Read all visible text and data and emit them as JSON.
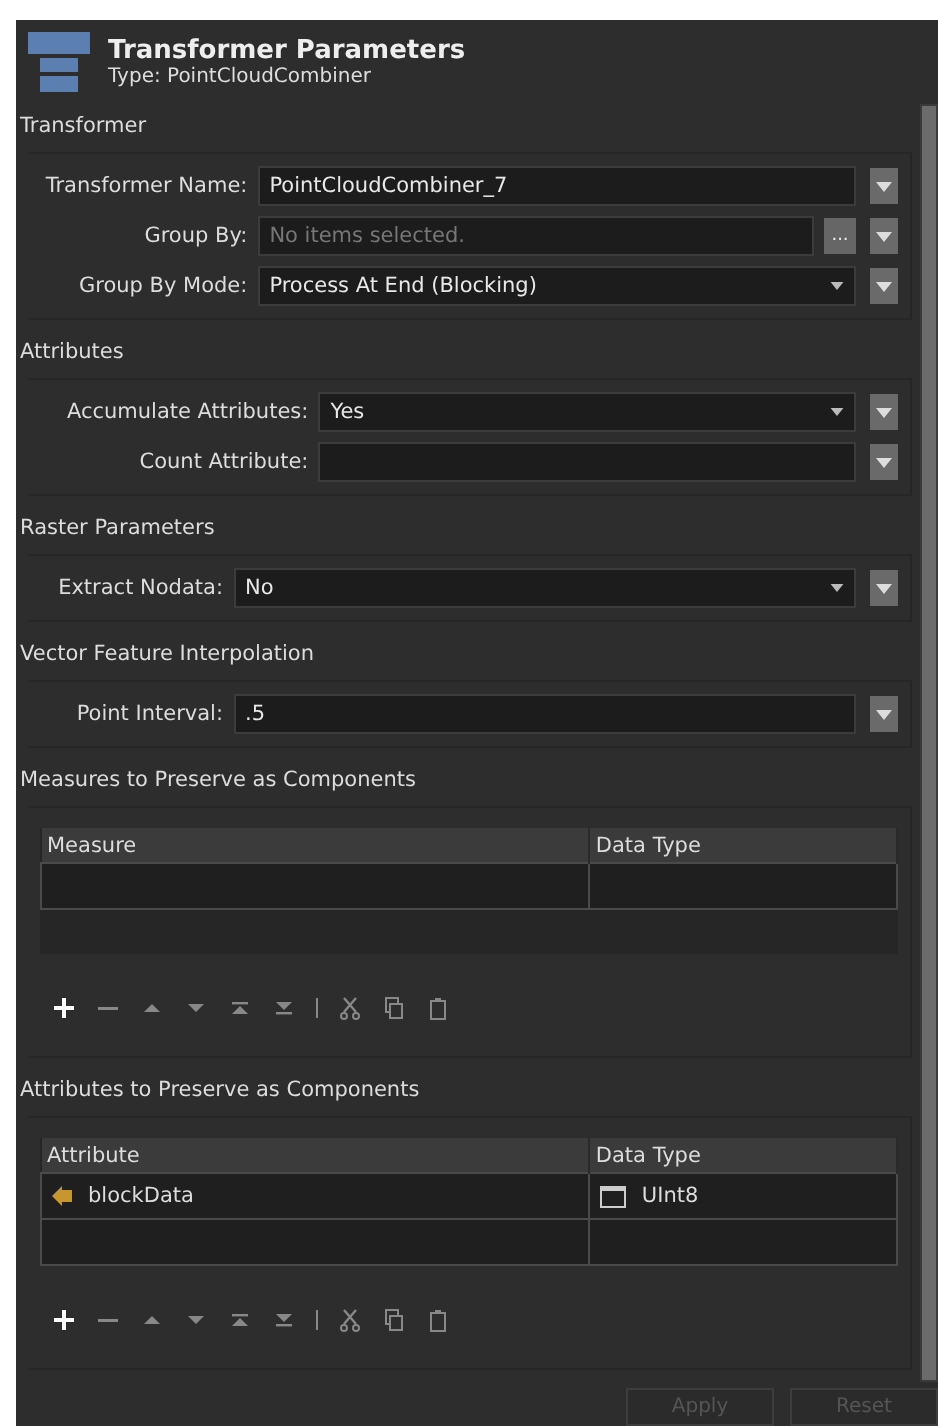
{
  "header": {
    "title": "Transformer Parameters",
    "subtitle": "Type: PointCloudCombiner"
  },
  "sections": [
    {
      "title": "Transformer",
      "kind": "form",
      "fields": [
        {
          "label": "Transformer Name:",
          "kind": "text",
          "value": "PointCloudCombiner_7"
        },
        {
          "label": "Group By:",
          "kind": "chooser",
          "placeholder": "No items selected.",
          "button": "..."
        },
        {
          "label": "Group By Mode:",
          "kind": "select",
          "value": "Process At End (Blocking)"
        }
      ]
    },
    {
      "title": "Attributes",
      "kind": "form",
      "fields": [
        {
          "label": "Accumulate Attributes:",
          "kind": "select",
          "value": "Yes"
        },
        {
          "label": "Count Attribute:",
          "kind": "text"
        }
      ]
    },
    {
      "title": "Raster Parameters",
      "kind": "form",
      "fields": [
        {
          "label": "Extract Nodata:",
          "kind": "select",
          "value": "No"
        }
      ]
    },
    {
      "title": "Vector Feature Interpolation",
      "kind": "form",
      "fields": [
        {
          "label": "Point Interval:",
          "kind": "text",
          "value": ".5"
        }
      ]
    },
    {
      "title": "Measures to Preserve as Components",
      "kind": "table",
      "columns": [
        "Measure",
        "Data Type"
      ],
      "toolbar": [
        {
          "kind": "add",
          "disabled": false
        },
        {
          "kind": "remove",
          "disabled": true
        },
        {
          "kind": "up",
          "disabled": true
        },
        {
          "kind": "down",
          "disabled": true
        },
        {
          "kind": "top",
          "disabled": true
        },
        {
          "kind": "bottom",
          "disabled": true
        },
        {
          "kind": "cut",
          "disabled": true
        },
        {
          "kind": "copy",
          "disabled": true
        },
        {
          "kind": "paste",
          "disabled": true
        }
      ]
    },
    {
      "title": "Attributes to Preserve as Components",
      "kind": "table",
      "columns": [
        "Attribute",
        "Data Type"
      ],
      "rows": [
        {
          "name": "blockData",
          "type": "UInt8"
        }
      ],
      "toolbar": [
        {
          "kind": "add",
          "disabled": false
        },
        {
          "kind": "remove",
          "disabled": true
        },
        {
          "kind": "up",
          "disabled": true
        },
        {
          "kind": "down",
          "disabled": true
        },
        {
          "kind": "top",
          "disabled": true
        },
        {
          "kind": "bottom",
          "disabled": true
        },
        {
          "kind": "cut",
          "disabled": true
        },
        {
          "kind": "copy",
          "disabled": true
        },
        {
          "kind": "paste",
          "disabled": true
        }
      ]
    }
  ],
  "buttons": [
    {
      "label": "Apply",
      "disabled": true
    },
    {
      "label": "Reset",
      "disabled": true
    }
  ]
}
